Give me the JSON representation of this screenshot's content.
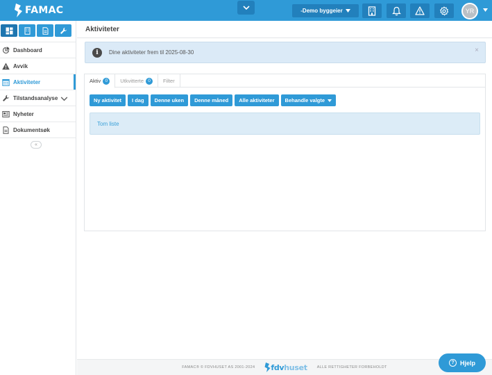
{
  "brand": {
    "name": "FAMAC"
  },
  "topbar": {
    "owner_dropdown": "-Demo byggeier",
    "avatar_initials": "YR",
    "icons": [
      "building-icon",
      "bell-icon",
      "warning-icon",
      "gear-icon"
    ]
  },
  "sidebar": {
    "tabs": [
      "dashboard-grid-icon",
      "building-icon",
      "document-icon",
      "wrench-icon"
    ],
    "items": [
      {
        "label": "Dashboard",
        "icon": "pie-chart-icon"
      },
      {
        "label": "Avvik",
        "icon": "warning-icon"
      },
      {
        "label": "Aktiviteter",
        "icon": "calendar-icon",
        "active": true
      },
      {
        "label": "Tilstandsanalyse",
        "icon": "wrench-icon",
        "expandable": true
      },
      {
        "label": "Nyheter",
        "icon": "newspaper-icon"
      },
      {
        "label": "Dokumentsøk",
        "icon": "document-icon"
      }
    ],
    "collapse_label": "«"
  },
  "page": {
    "title": "Aktiviteter"
  },
  "alert": {
    "text": "Dine aktiviteter frem til 2025-08-30",
    "close": "×"
  },
  "tabs": [
    {
      "label": "Aktiv",
      "count": "0",
      "active": true
    },
    {
      "label": "Utkvitterte",
      "count": "0"
    },
    {
      "label": "Filter"
    }
  ],
  "actions": {
    "new": "Ny aktivitet",
    "today": "I dag",
    "week": "Denne uken",
    "month": "Denne måned",
    "all": "Alle aktiviteter",
    "handle": "Behandle valgte"
  },
  "list": {
    "empty_text": "Tom liste"
  },
  "footer": {
    "copyright": "FAMAC® © FDVHUSET AS 2001-2024",
    "logo_main": "fdv",
    "logo_light": "huset",
    "rights": "ALLE RETTIGHETER FORBEHOLDT"
  },
  "help": {
    "label": "Hjelp"
  },
  "colors": {
    "primary": "#2f9ad7",
    "primary_dark": "#2280bc",
    "alert_bg": "#dbeaf7"
  }
}
